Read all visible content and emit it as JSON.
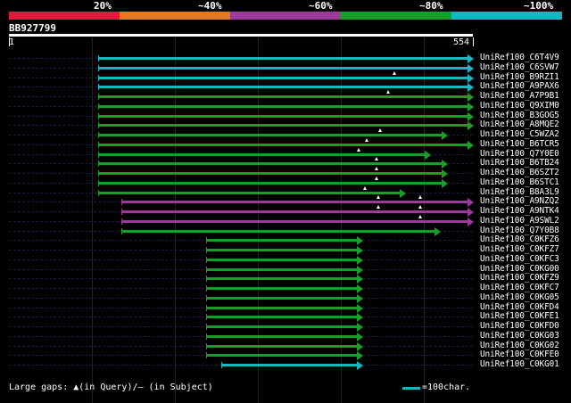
{
  "scale": {
    "segments": [
      {
        "label": "20%",
        "color": "#e8173c"
      },
      {
        "label": "~40%",
        "color": "#e07a20"
      },
      {
        "label": "~60%",
        "color": "#9b3a9b"
      },
      {
        "label": "~80%",
        "color": "#1a9e2a"
      },
      {
        "label": "~100%",
        "color": "#18b5c2"
      }
    ]
  },
  "query": {
    "id": "BB927799",
    "start": "1",
    "end": "554",
    "length": 554
  },
  "colors": {
    "cyan": "#18b5c2",
    "green": "#1a9e2a",
    "purple": "#9b3a9b",
    "white": "#ffffff"
  },
  "hits": [
    {
      "label": "UniRef100_C6T4V9",
      "color": "cyan",
      "start": 1,
      "end": 554,
      "gaps": []
    },
    {
      "label": "UniRef100_C6SVW7",
      "color": "cyan",
      "start": 1,
      "end": 554,
      "gaps": []
    },
    {
      "label": "UniRef100_B9RZI1",
      "color": "cyan",
      "start": 1,
      "end": 554,
      "gaps": [
        445
      ]
    },
    {
      "label": "UniRef100_A9PAX6",
      "color": "cyan",
      "start": 1,
      "end": 554,
      "gaps": []
    },
    {
      "label": "UniRef100_A7P9B1",
      "color": "green",
      "start": 1,
      "end": 554,
      "gaps": [
        435
      ]
    },
    {
      "label": "UniRef100_Q9XIM0",
      "color": "green",
      "start": 1,
      "end": 554,
      "gaps": []
    },
    {
      "label": "UniRef100_B3GOG5",
      "color": "green",
      "start": 1,
      "end": 554,
      "gaps": []
    },
    {
      "label": "UniRef100_A8MQE2",
      "color": "green",
      "start": 1,
      "end": 554,
      "gaps": []
    },
    {
      "label": "UniRef100_C5WZA2",
      "color": "green",
      "start": 1,
      "end": 515,
      "gaps": [
        423
      ]
    },
    {
      "label": "UniRef100_B6TCR5",
      "color": "green",
      "start": 1,
      "end": 554,
      "gaps": [
        403
      ]
    },
    {
      "label": "UniRef100_Q7Y0E0",
      "color": "green",
      "start": 1,
      "end": 490,
      "gaps": [
        391
      ]
    },
    {
      "label": "UniRef100_B6TB24",
      "color": "green",
      "start": 1,
      "end": 515,
      "gaps": [
        418
      ]
    },
    {
      "label": "UniRef100_B6SZT2",
      "color": "green",
      "start": 1,
      "end": 515,
      "gaps": [
        418
      ]
    },
    {
      "label": "UniRef100_B6STC1",
      "color": "green",
      "start": 1,
      "end": 515,
      "gaps": [
        418
      ]
    },
    {
      "label": "UniRef100_B8A3L9",
      "color": "green",
      "start": 1,
      "end": 453,
      "gaps": [
        401
      ]
    },
    {
      "label": "UniRef100_A9NZQ2",
      "color": "purple",
      "start": 36,
      "end": 554,
      "gaps": [
        420,
        483
      ]
    },
    {
      "label": "UniRef100_A9NTK4",
      "color": "purple",
      "start": 36,
      "end": 554,
      "gaps": [
        420,
        483
      ]
    },
    {
      "label": "UniRef100_A9SWL2",
      "color": "purple",
      "start": 36,
      "end": 554,
      "gaps": [
        483
      ]
    },
    {
      "label": "UniRef100_Q7Y0B8",
      "color": "green",
      "start": 36,
      "end": 504,
      "gaps": []
    },
    {
      "label": "UniRef100_C0KFZ6",
      "color": "green",
      "start": 162,
      "end": 388,
      "gaps": []
    },
    {
      "label": "UniRef100_C0KFZ7",
      "color": "green",
      "start": 162,
      "end": 388,
      "gaps": []
    },
    {
      "label": "UniRef100_C0KFC3",
      "color": "green",
      "start": 162,
      "end": 388,
      "gaps": []
    },
    {
      "label": "UniRef100_C0KG00",
      "color": "green",
      "start": 162,
      "end": 388,
      "gaps": []
    },
    {
      "label": "UniRef100_C0KFZ9",
      "color": "green",
      "start": 162,
      "end": 388,
      "gaps": []
    },
    {
      "label": "UniRef100_C0KFC7",
      "color": "green",
      "start": 162,
      "end": 388,
      "gaps": []
    },
    {
      "label": "UniRef100_C0KG05",
      "color": "green",
      "start": 162,
      "end": 388,
      "gaps": []
    },
    {
      "label": "UniRef100_C0KFD4",
      "color": "green",
      "start": 162,
      "end": 388,
      "gaps": []
    },
    {
      "label": "UniRef100_C0KFE1",
      "color": "green",
      "start": 162,
      "end": 388,
      "gaps": []
    },
    {
      "label": "UniRef100_C0KFD0",
      "color": "green",
      "start": 162,
      "end": 388,
      "gaps": []
    },
    {
      "label": "UniRef100_C0KG03",
      "color": "green",
      "start": 162,
      "end": 388,
      "gaps": []
    },
    {
      "label": "UniRef100_C0KG02",
      "color": "green",
      "start": 162,
      "end": 388,
      "gaps": []
    },
    {
      "label": "UniRef100_C0KFE0",
      "color": "green",
      "start": 162,
      "end": 388,
      "gaps": []
    },
    {
      "label": "UniRef100_C0KG01",
      "color": "cyan",
      "start": 185,
      "end": 388,
      "gaps": []
    }
  ],
  "footer": {
    "gaps_text": "Large gaps: ▲(in Query)/— (in Subject)",
    "legend_text": "=100char."
  }
}
